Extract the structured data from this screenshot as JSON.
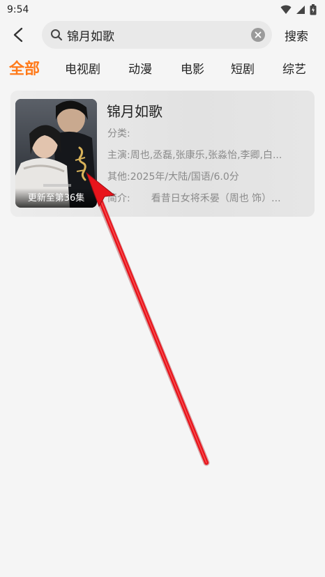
{
  "status_bar": {
    "time": "9:54",
    "icons": [
      "wifi-icon",
      "signal-icon",
      "battery-icon"
    ]
  },
  "search": {
    "query": "锦月如歌",
    "search_label": "搜索"
  },
  "tabs": [
    {
      "label": "全部",
      "active": true
    },
    {
      "label": "电视剧",
      "active": false
    },
    {
      "label": "动漫",
      "active": false
    },
    {
      "label": "电影",
      "active": false
    },
    {
      "label": "短剧",
      "active": false
    },
    {
      "label": "综艺",
      "active": false
    }
  ],
  "result": {
    "title": "锦月如歌",
    "poster_caption": "更新至第36集",
    "category_label": "分类:",
    "category_value": "",
    "cast_label": "主演:",
    "cast_value": "周也,丞磊,张康乐,张淼怡,李卿,白...",
    "other_label": "其他:",
    "other_value": "2025年/大陆/国语/6.0分",
    "intro_label": "简介:",
    "intro_value": "看昔日女将禾晏（周也 饰）..."
  },
  "colors": {
    "accent": "#ff7a1a",
    "background": "#f5f5f5",
    "search_box": "#e9e9e9",
    "annotation": "#e8141c"
  }
}
